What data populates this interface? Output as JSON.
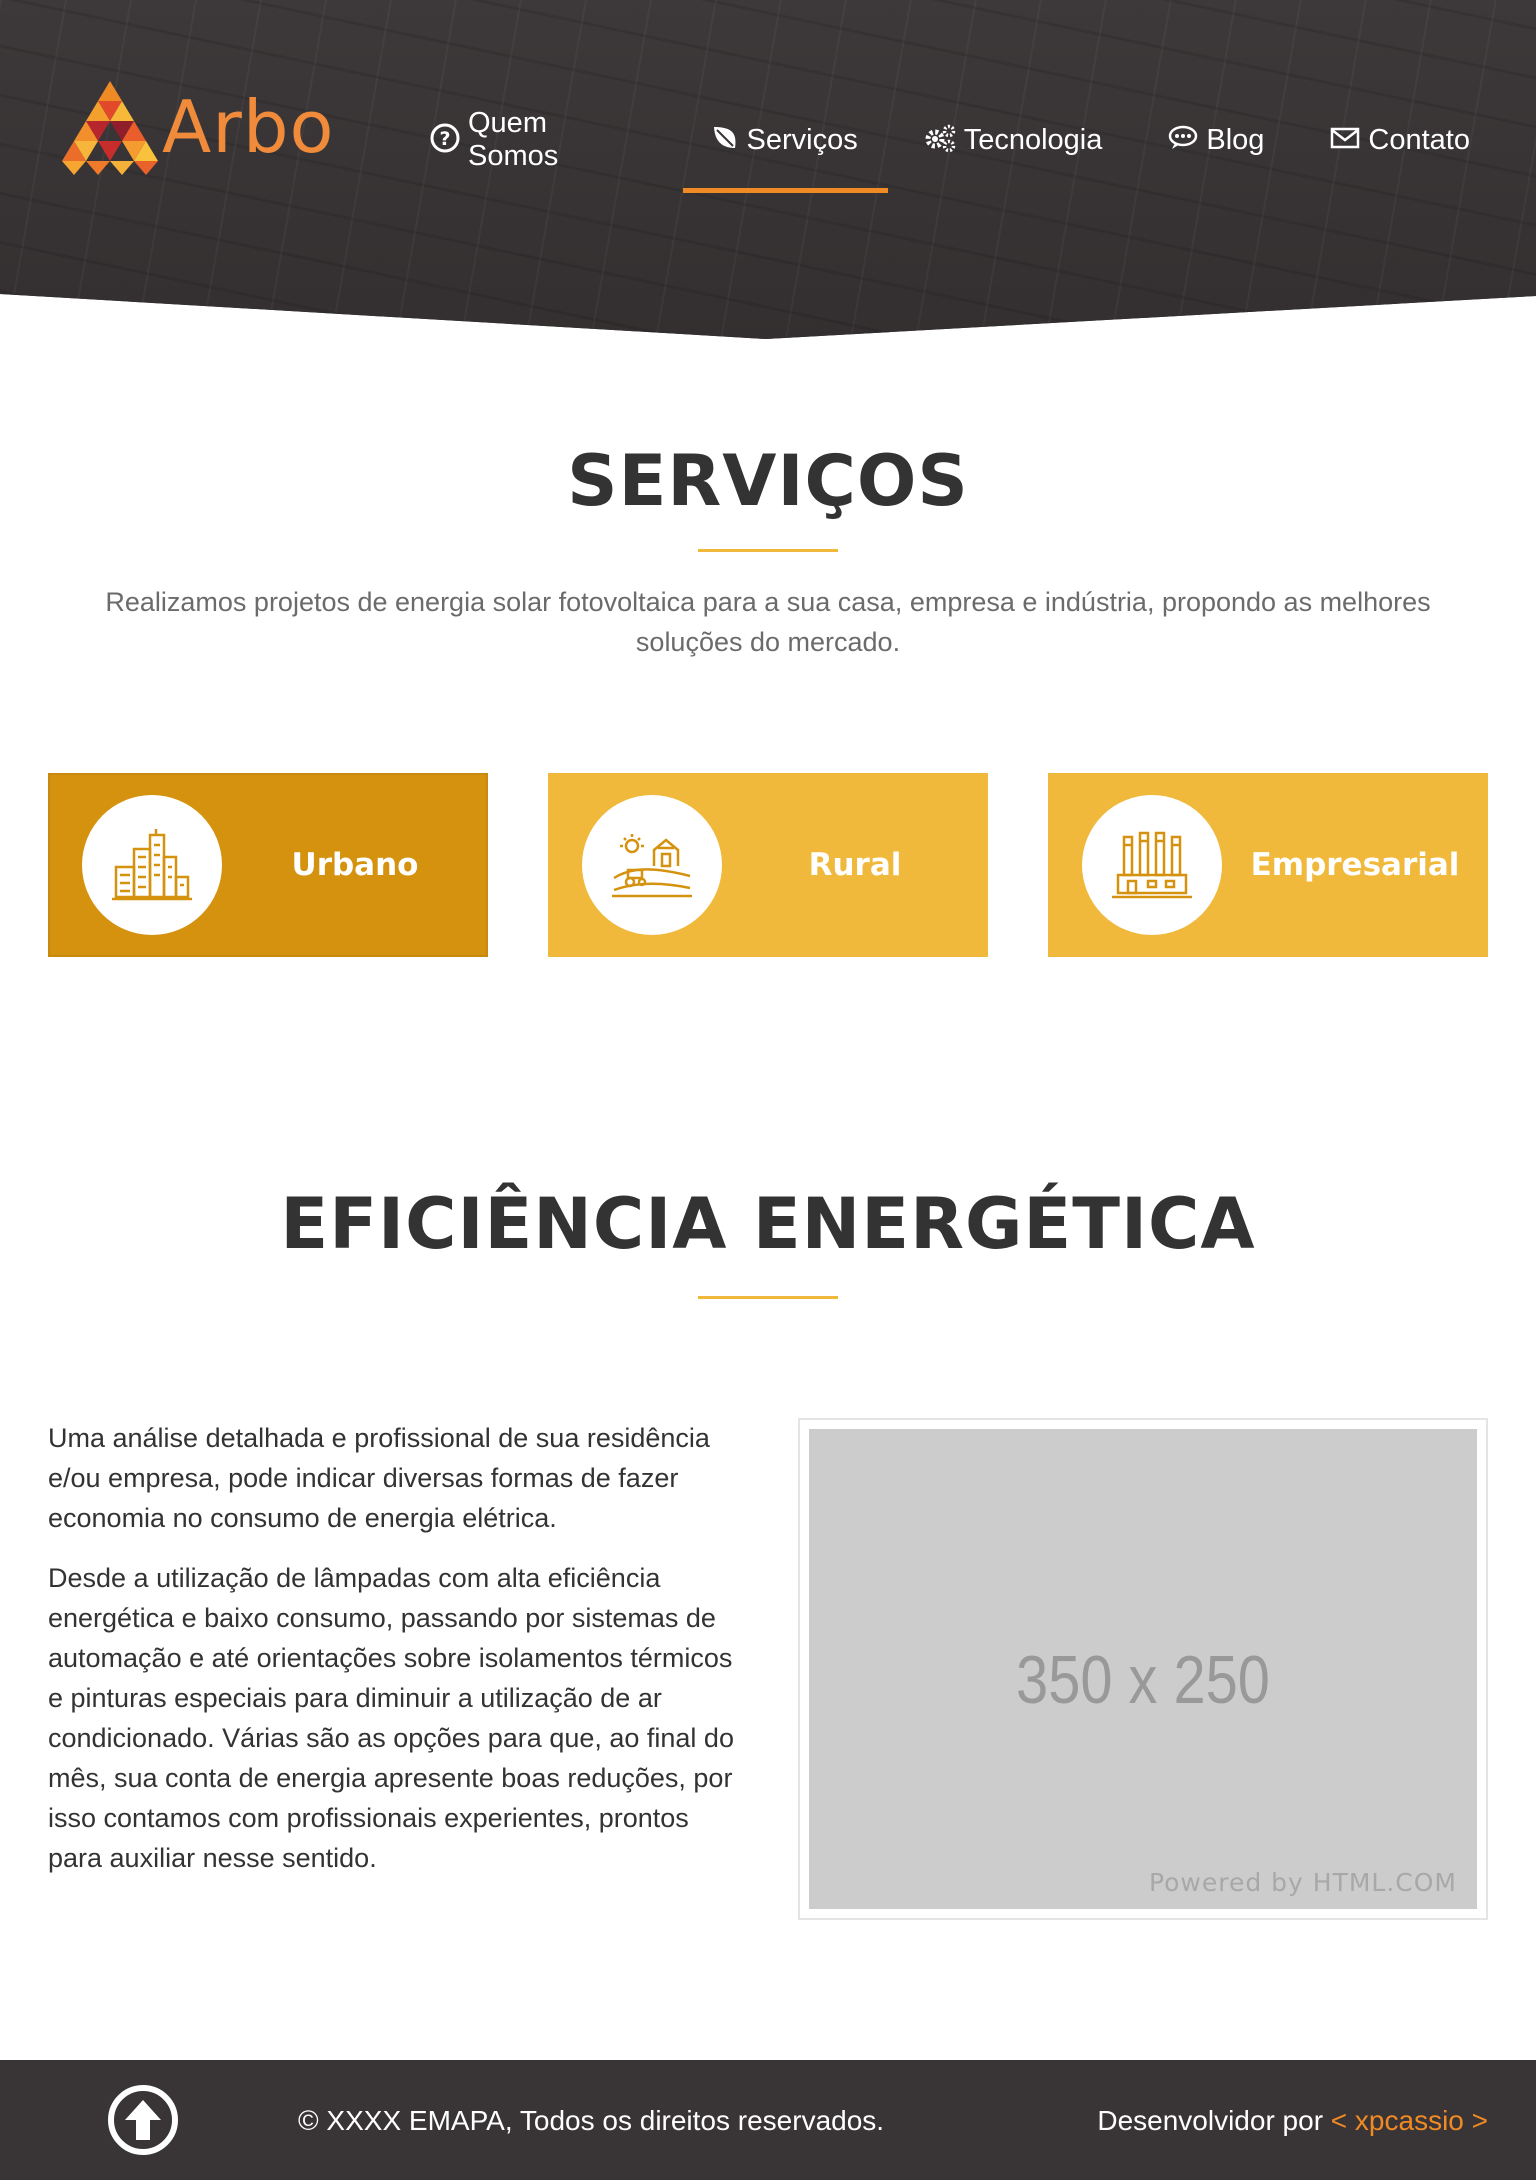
{
  "header": {
    "logo_text": "Arbo",
    "nav": [
      {
        "label": "Quem Somos",
        "icon": "question-circle-icon",
        "active": false
      },
      {
        "label": "Serviços",
        "icon": "leaf-icon",
        "active": true
      },
      {
        "label": "Tecnologia",
        "icon": "cogs-icon",
        "active": false
      },
      {
        "label": "Blog",
        "icon": "comment-dots-icon",
        "active": false
      },
      {
        "label": "Contato",
        "icon": "envelope-icon",
        "active": false
      }
    ]
  },
  "servicos": {
    "title": "SERVIÇOS",
    "intro": "Realizamos projetos de energia solar fotovoltaica para a sua casa, empresa e indústria, propondo as melhores soluções do mercado.",
    "cards": [
      {
        "label": "Urbano",
        "icon": "city-buildings-icon",
        "active": true
      },
      {
        "label": "Rural",
        "icon": "farm-barn-icon",
        "active": false
      },
      {
        "label": "Empresarial",
        "icon": "factory-icon",
        "active": false
      }
    ]
  },
  "eficiencia": {
    "title": "EFICIÊNCIA ENERGÉTICA",
    "paragraphs": [
      "Uma análise detalhada e profissional de sua residência e/ou empresa, pode indicar diversas formas de fazer economia no consumo de energia elétrica.",
      "Desde a utilização de lâmpadas com alta eficiência energética e baixo consumo, passando por sistemas de automação e até orientações sobre isolamentos térmicos e pinturas especiais para diminuir a utilização de ar condicionado. Várias são as opções para que, ao final do mês, sua conta de energia apresente boas reduções, por isso contamos com profissionais experientes, prontos para auxiliar nesse sentido."
    ],
    "image": {
      "dimensions": "350 x 250",
      "powered_by": "Powered by HTML.COM"
    }
  },
  "footer": {
    "copyright": "© XXXX EMAPA, Todos os direitos reservados.",
    "dev_prefix": "Desenvolvidor por",
    "dev_link": "< xpcassio >"
  },
  "colors": {
    "accent_orange": "#f08a24",
    "card_yellow": "#f0b93b",
    "card_active": "#d4920e",
    "dark": "#393536"
  }
}
